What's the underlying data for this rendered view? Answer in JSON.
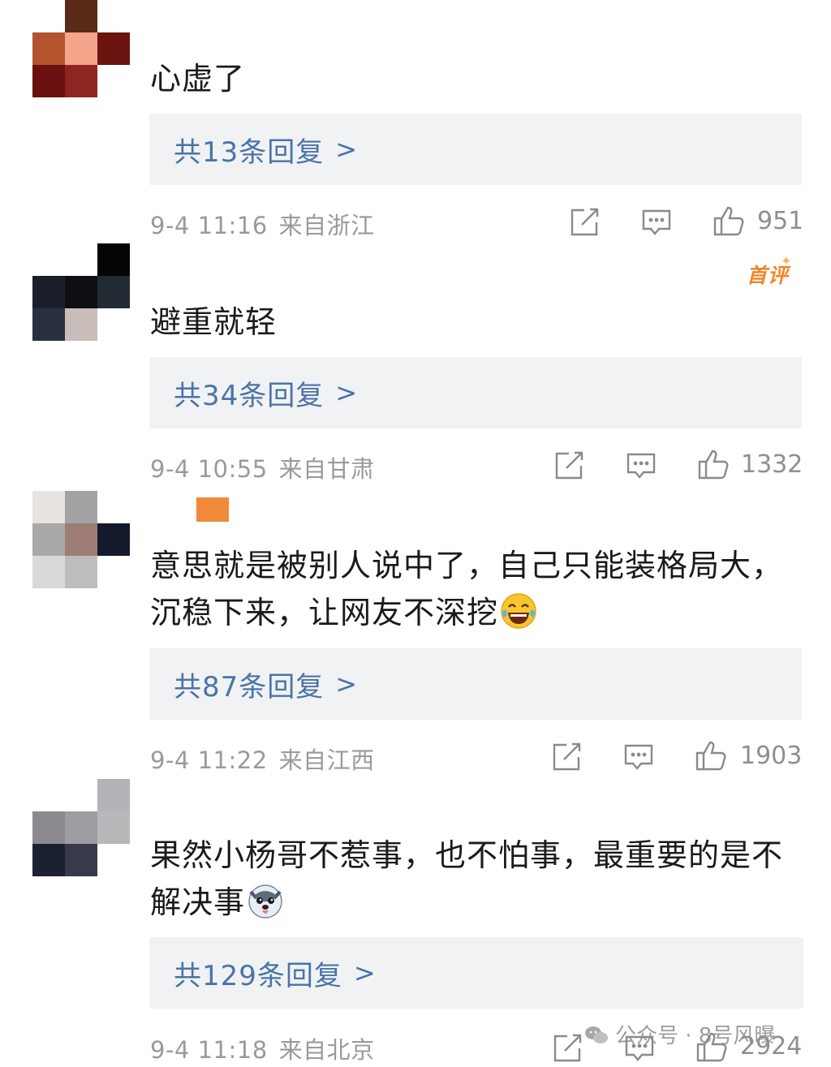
{
  "colors": {
    "reply_link": "#4a74a8",
    "reply_bg": "#f1f2f4",
    "meta_text": "#9a9a9a",
    "badge": "#f0862a"
  },
  "comments": [
    {
      "text_lines": [
        "心虚了"
      ],
      "reply_label": "共13条回复",
      "reply_arrow": ">",
      "date": "9-4 11:16",
      "location": "来自浙江",
      "likes": "951",
      "avatar_pixels": [
        "#5a2a18",
        "#b4542f",
        "#f4a58c",
        "#6b1410",
        "#6a1010",
        "#8f2520"
      ]
    },
    {
      "badge": "首评",
      "text_lines": [
        "避重就轻"
      ],
      "reply_label": "共34条回复",
      "reply_arrow": ">",
      "date": "9-4 10:55",
      "location": "来自甘肃",
      "likes": "1332",
      "avatar_pixels": [
        "#050505",
        "#1b1f29",
        "#0e0f12",
        "#222a33",
        "#2b3040",
        "#c9bdb9"
      ]
    },
    {
      "text_lines": [
        "意思就是被别人说中了，自己只能装格局大，",
        "沉稳下来，让网友不深挖"
      ],
      "emoji": "laughing-crying-emoji",
      "reply_label": "共87条回复",
      "reply_arrow": ">",
      "date": "9-4 11:22",
      "location": "来自江西",
      "likes": "1903",
      "avatar_pixels": [
        "#e6e3e1",
        "#a2a2a2",
        "#a9a9a9",
        "#9d7d74",
        "#141a2c",
        "#d9d9d9",
        "#bdbdbd"
      ]
    },
    {
      "text_lines": [
        "果然小杨哥不惹事，也不怕事，最重要的是不",
        "解决事"
      ],
      "emoji": "husky-dog-emoji",
      "reply_label": "共129条回复",
      "reply_arrow": ">",
      "date": "9-4 11:18",
      "location": "来自北京",
      "likes": "2924",
      "avatar_pixels": [
        "#b4b4b8",
        "#8b8b8f",
        "#9e9ea2",
        "#b8b8bb",
        "#1c2130",
        "#383a4a"
      ]
    }
  ],
  "watermark": {
    "text": "公众号 · 8号风曝",
    "icon": "wechat-icon"
  }
}
